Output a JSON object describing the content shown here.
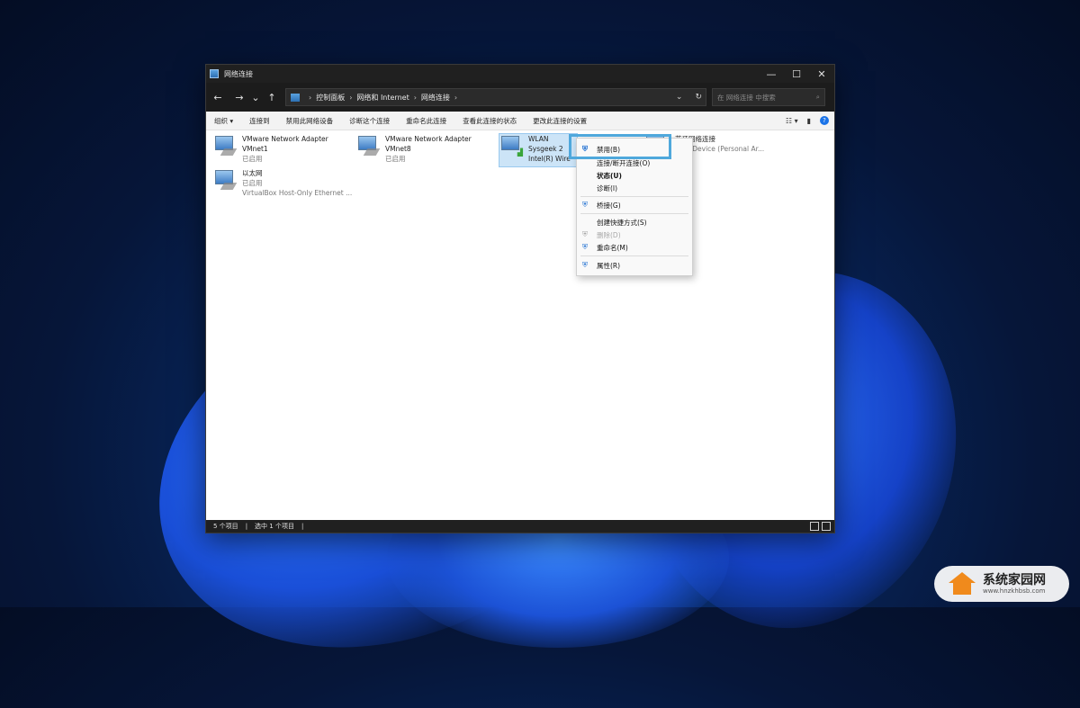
{
  "window": {
    "title": "网络连接",
    "min": "—",
    "max": "☐",
    "close": "✕"
  },
  "nav": {
    "back": "←",
    "forward": "→",
    "recent": "⌄",
    "up": "↑"
  },
  "address": {
    "crumbs": [
      "控制面板",
      "网络和 Internet",
      "网络连接"
    ],
    "arrow": "›",
    "dropdown": "⌄",
    "refresh": "↻"
  },
  "search": {
    "placeholder": "在 网络连接 中搜索",
    "icon": "⌕"
  },
  "toolbar": {
    "organize": "组织 ▾",
    "connect_to": "连接到",
    "disable": "禁用此网络设备",
    "diagnose": "诊断这个连接",
    "rename": "重命名此连接",
    "status": "查看此连接的状态",
    "settings": "更改此连接的设置",
    "view": "☷ ▾",
    "pane": "▮",
    "help": "?"
  },
  "items": [
    {
      "name": "VMware Network Adapter",
      "line2": "VMnet1",
      "line3": "已启用"
    },
    {
      "name": "VMware Network Adapter",
      "line2": "VMnet8",
      "line3": "已启用"
    },
    {
      "name": "WLAN",
      "line2": "Sysgeek 2",
      "line3": "Intel(R) Wire"
    },
    {
      "name": "蓝牙网络连接",
      "line2": "",
      "line3": "ooth Device (Personal Ar..."
    },
    {
      "name": "以太网",
      "line2": "已启用",
      "line3": "VirtualBox Host-Only Ethernet ..."
    }
  ],
  "context_menu": {
    "disable": "禁用(B)",
    "connect": "连接/断开连接(O)",
    "status": "状态(U)",
    "diagnose": "诊断(I)",
    "bridge": "桥接(G)",
    "shortcut": "创建快捷方式(S)",
    "delete": "删除(D)",
    "rename": "重命名(M)",
    "properties": "属性(R)",
    "shield": "⛨"
  },
  "statusbar": {
    "count": "5 个项目",
    "selected": "选中 1 个项目",
    "sep": "|"
  },
  "watermark": {
    "title": "系统家园网",
    "url": "www.hnzkhbsb.com"
  },
  "colors": {
    "accent": "#4fa8dc",
    "titlebar": "#202020",
    "selection": "#cce4f7"
  }
}
